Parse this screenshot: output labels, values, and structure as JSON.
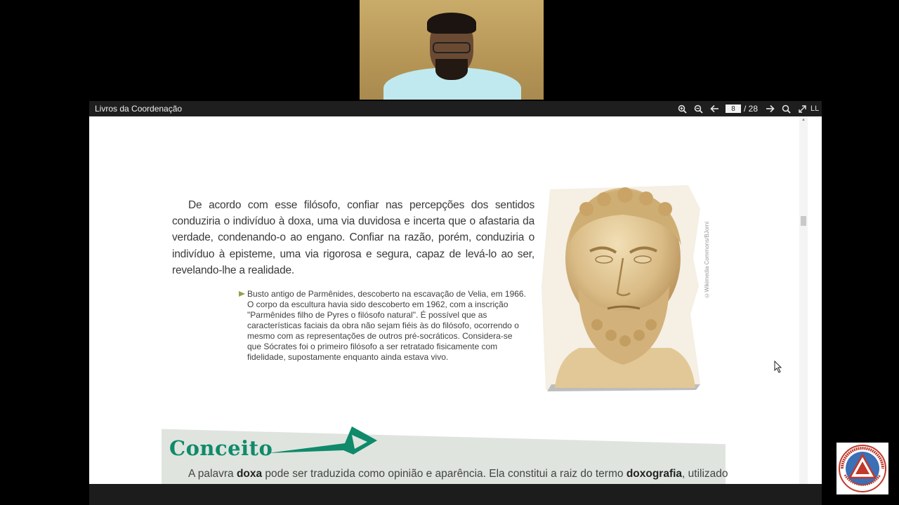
{
  "viewer": {
    "title": "Livros da Coordenação",
    "current_page": "8",
    "page_total": "/ 28",
    "more_label": "LL"
  },
  "icons": {
    "zoom_in": "zoom-in-icon",
    "zoom_out": "zoom-out-icon",
    "prev": "arrow-left-icon",
    "next": "arrow-right-icon",
    "search": "search-icon",
    "fullscreen": "fullscreen-icon"
  },
  "document": {
    "paragraph": "De acordo com esse filósofo, confiar nas percepções dos sentidos conduziria o indivíduo à doxa, uma via duvidosa e incerta que o afastaria da verdade, condenando-o ao engano. Confiar na razão, porém, conduziria o indivíduo à episteme, uma via rigorosa e segura, capaz de levá-lo ao ser, revelando-lhe a realidade.",
    "caption": "Busto antigo de Parmênides, descoberto na escavação de Velia, em 1966. O corpo da escultura havia sido descoberto em 1962, com a inscrição \"Parmênides filho de Pyres o filósofo natural\". É possível que as características faciais da obra não sejam fiéis às do filósofo, ocorrendo o mesmo com as representações de outros pré-socráticos. Considera-se que Sócrates foi o primeiro filósofo a ser retratado fisicamente com fidelidade, supostamente enquanto ainda estava vivo.",
    "image_credit": "©Wikimedia Commons/BJorni",
    "concept_title": "Conceito",
    "concept_text_1": "A palavra ",
    "concept_bold_1": "doxa",
    "concept_text_2": " pode ser traduzida como opinião e aparência. Ela constitui a raiz do termo ",
    "concept_bold_2": "doxografia",
    "concept_text_3": ", utilizado"
  },
  "logo": {
    "text_top": "COLÉGIO CASTRO ALVES",
    "text_bottom": "PROMOVENDO A PAZ"
  },
  "colors": {
    "accent_green": "#0f8a6b",
    "caption_marker": "#8fa24f",
    "toolbar_bg": "#1e1e1e"
  }
}
